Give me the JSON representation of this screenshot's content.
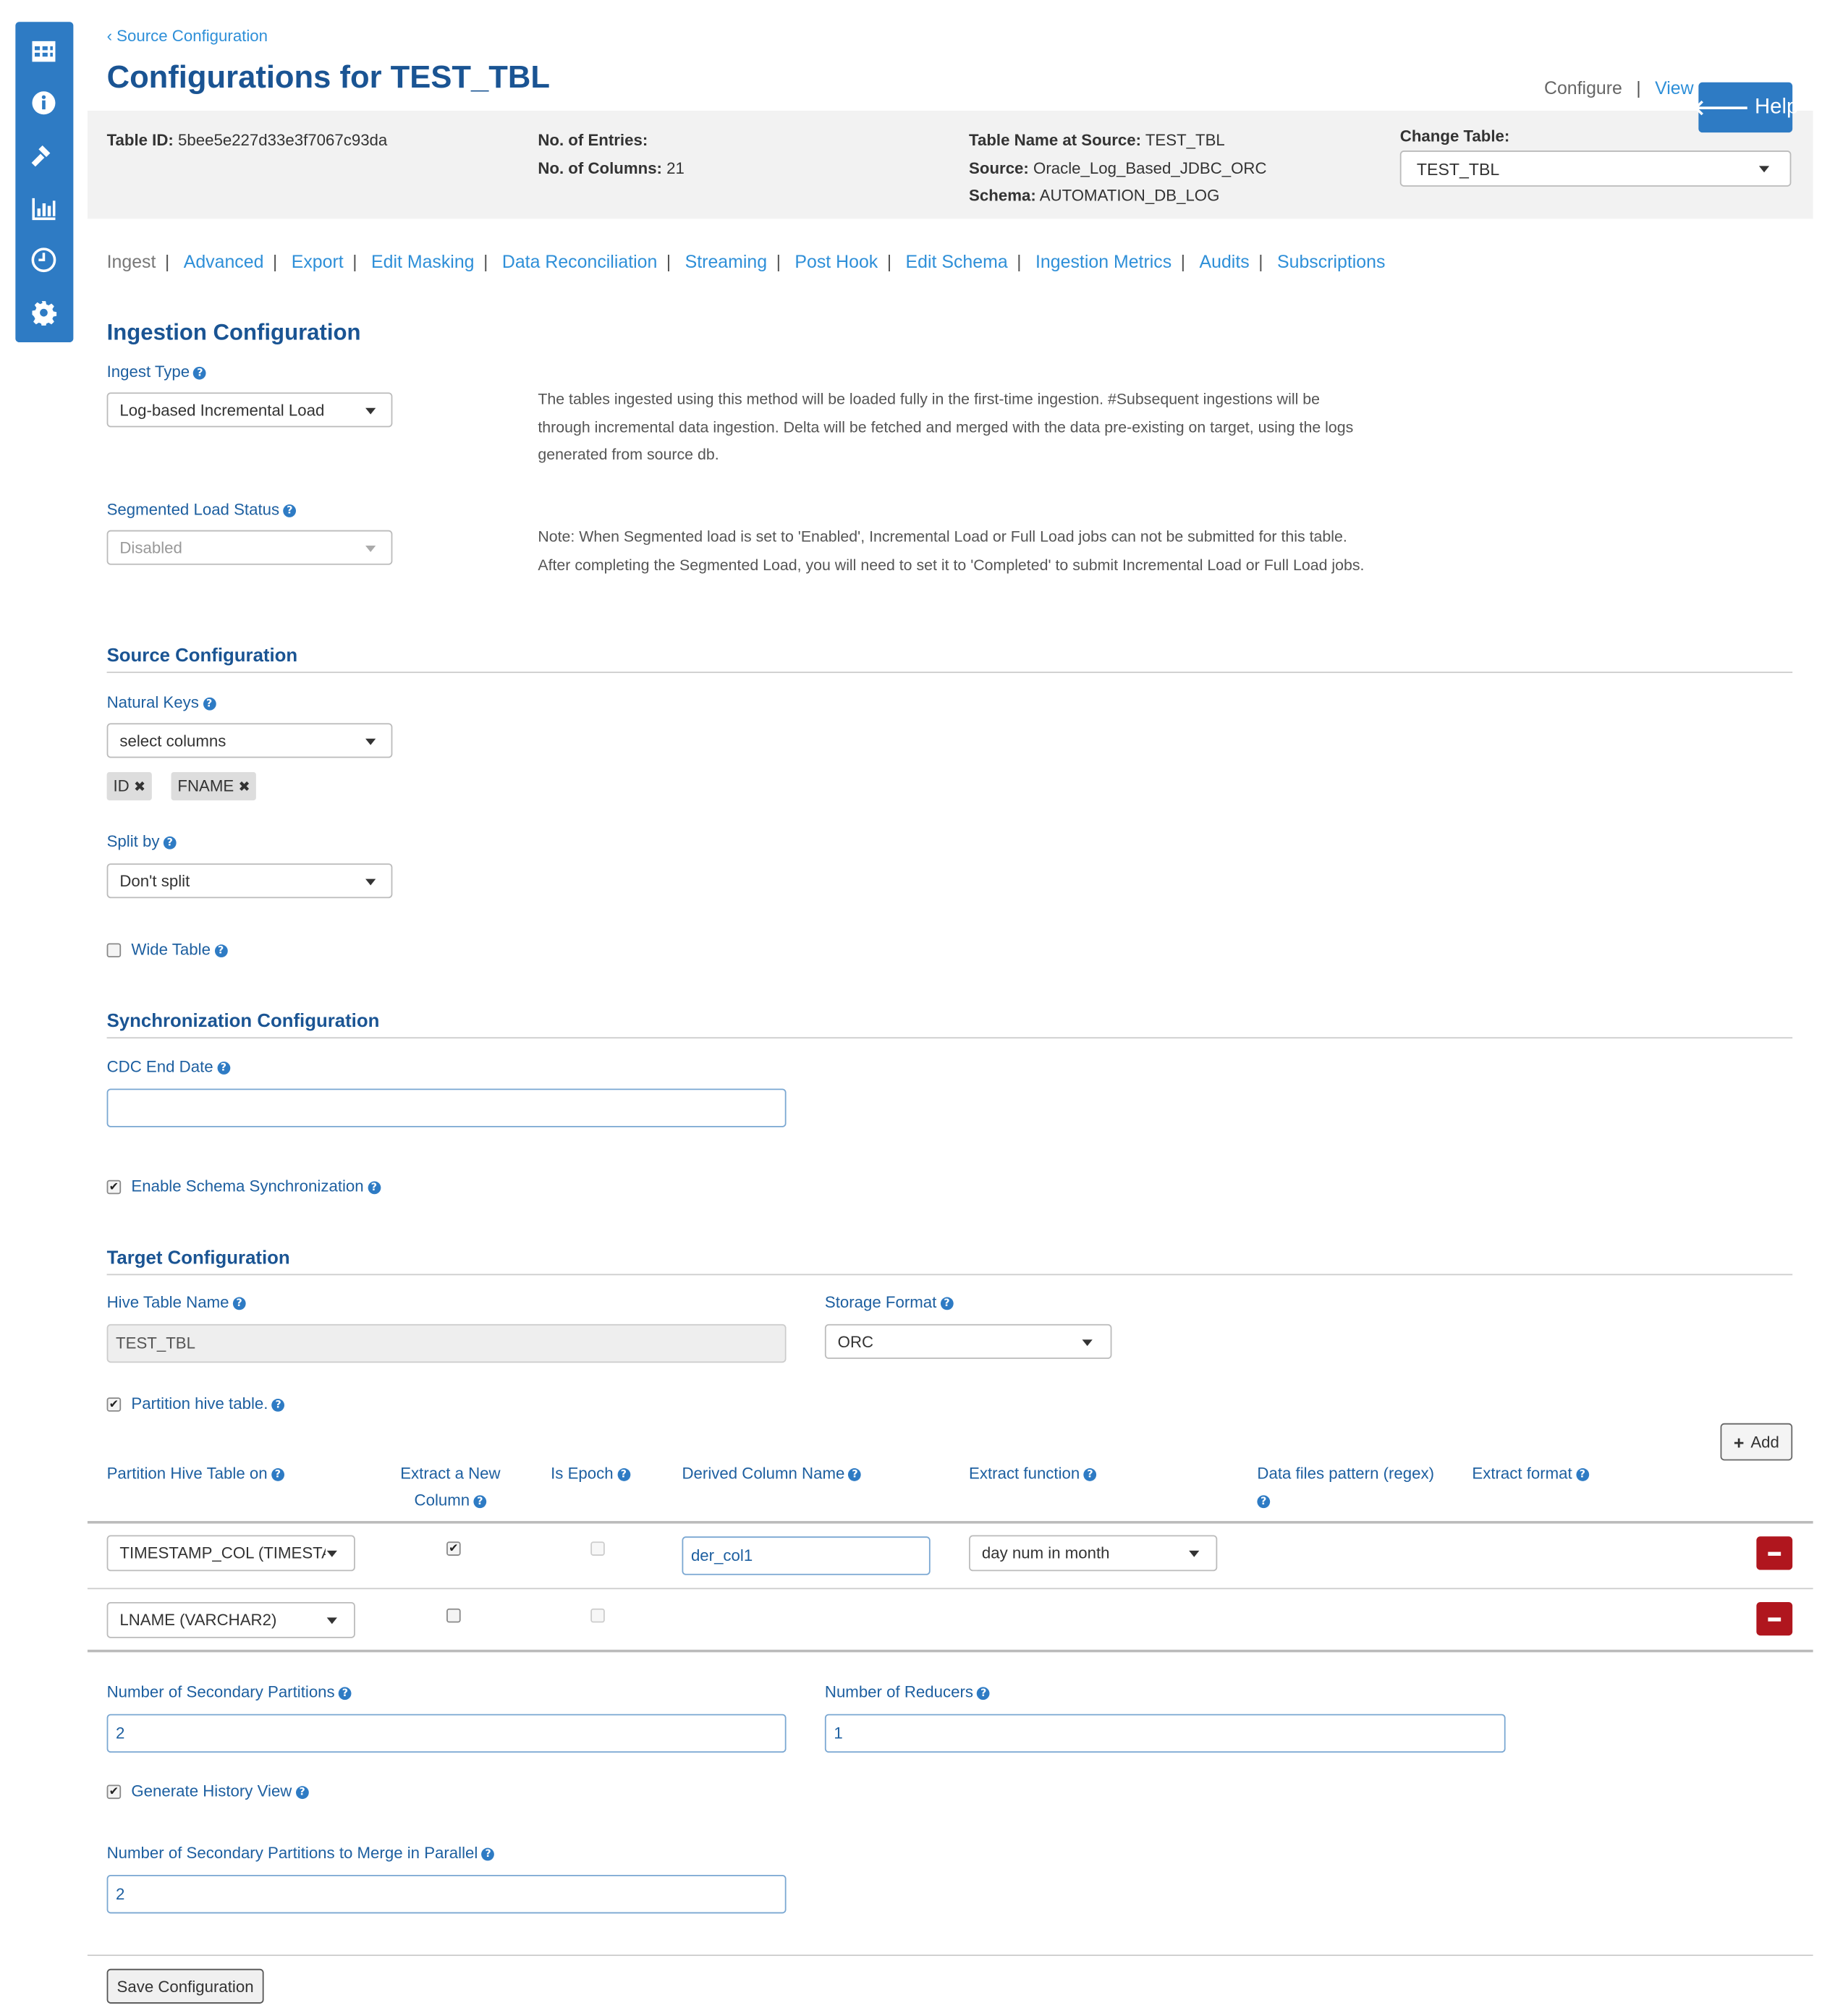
{
  "breadcrumb": {
    "back_label": "Source Configuration"
  },
  "page_title": "Configurations for TEST_TBL",
  "top_nav": {
    "configure": "Configure",
    "view": "View",
    "help": "Help"
  },
  "summary": {
    "table_id_label": "Table ID:",
    "table_id": "5bee5e227d33e3f7067c93da",
    "entries_label": "No. of Entries:",
    "entries": "",
    "columns_label": "No. of Columns:",
    "columns": "21",
    "source_name_label": "Table Name at Source:",
    "source_name": "TEST_TBL",
    "source_label": "Source:",
    "source": "Oracle_Log_Based_JDBC_ORC",
    "schema_label": "Schema:",
    "schema": "AUTOMATION_DB_LOG",
    "change_table_label": "Change Table:",
    "change_table_value": "TEST_TBL"
  },
  "tabs": [
    "Ingest",
    "Advanced",
    "Export",
    "Edit Masking",
    "Data Reconciliation",
    "Streaming",
    "Post Hook",
    "Edit Schema",
    "Ingestion Metrics",
    "Audits",
    "Subscriptions"
  ],
  "ingestion": {
    "heading": "Ingestion Configuration",
    "ingest_type_label": "Ingest Type",
    "ingest_type_value": "Log-based Incremental Load",
    "ingest_type_help": "The tables ingested using this method will be loaded fully in the first-time ingestion. #Subsequent ingestions will be through incremental data ingestion. Delta will be fetched and merged with the data pre-existing on target, using the logs generated from source db.",
    "segmented_label": "Segmented Load Status",
    "segmented_value": "Disabled",
    "segmented_help": "Note: When Segmented load is set to 'Enabled', Incremental Load or Full Load jobs can not be submitted for this table. After completing the Segmented Load, you will need to set it to 'Completed' to submit Incremental Load or Full Load jobs."
  },
  "source": {
    "heading": "Source Configuration",
    "natural_keys_label": "Natural Keys",
    "natural_keys_placeholder": "select columns",
    "natural_keys_tags": [
      "ID",
      "FNAME"
    ],
    "split_by_label": "Split by",
    "split_by_value": "Don't split",
    "wide_table_label": "Wide Table",
    "wide_table_checked": false
  },
  "sync": {
    "heading": "Synchronization Configuration",
    "cdc_end_date_label": "CDC End Date",
    "cdc_end_date_value": "",
    "schema_sync_label": "Enable Schema Synchronization",
    "schema_sync_checked": true
  },
  "target": {
    "heading": "Target Configuration",
    "hive_table_label": "Hive Table Name",
    "hive_table_value": "TEST_TBL",
    "storage_format_label": "Storage Format",
    "storage_format_value": "ORC",
    "partition_label": "Partition hive table.",
    "partition_checked": true,
    "add_label": "Add",
    "partition_columns": {
      "partition_on": "Partition Hive Table on",
      "extract_new": "Extract a New Column",
      "is_epoch": "Is Epoch",
      "derived_name": "Derived Column Name",
      "extract_fn": "Extract function",
      "data_files_pattern": "Data files pattern (regex)",
      "extract_format": "Extract format"
    },
    "partition_rows": [
      {
        "column": "TIMESTAMP_COL (TIMESTA",
        "extract_new": true,
        "is_epoch": false,
        "derived_name": "der_col1",
        "extract_fn": "day num in month"
      },
      {
        "column": "LNAME (VARCHAR2)",
        "extract_new": false,
        "is_epoch": false
      }
    ],
    "secondary_partitions_label": "Number of Secondary Partitions",
    "secondary_partitions_value": "2",
    "reducers_label": "Number of Reducers",
    "reducers_value": "1",
    "history_view_label": "Generate History View",
    "history_view_checked": true,
    "merge_parallel_label": "Number of Secondary Partitions to Merge in Parallel",
    "merge_parallel_value": "2"
  },
  "save_label": "Save Configuration",
  "colors": {
    "sidebar": "#2e7bc4",
    "link": "#2e8fd8",
    "heading": "#1a5493",
    "remove": "#b0161e"
  }
}
